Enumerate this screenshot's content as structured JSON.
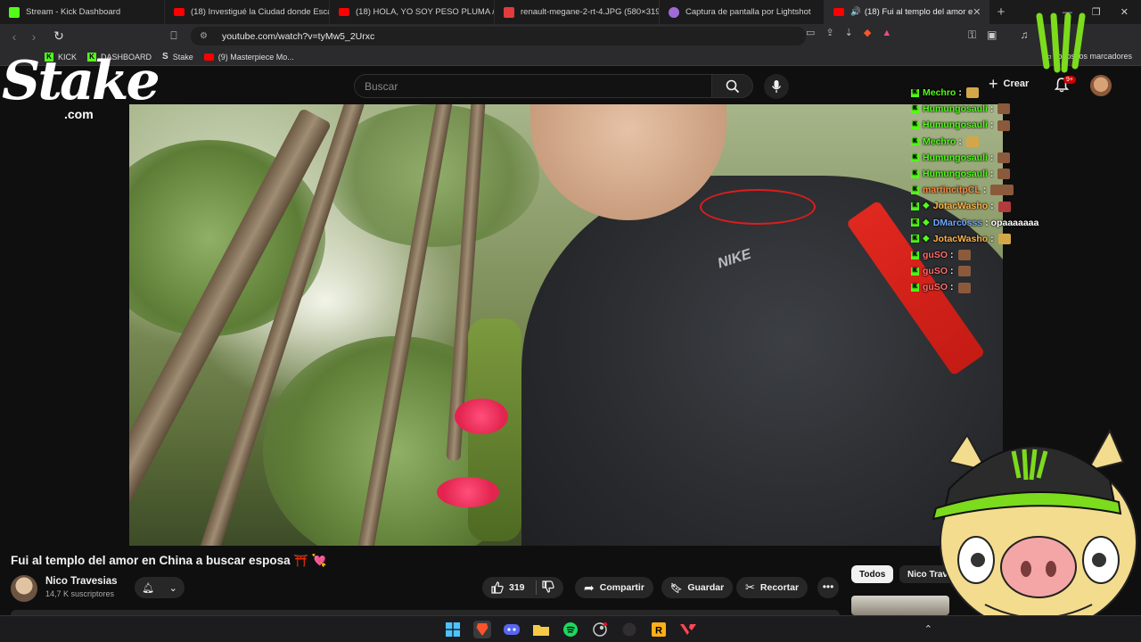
{
  "browser": {
    "tabs": [
      {
        "title": "Stream - Kick Dashboard",
        "favicon": "kick-icon",
        "color": "#53fc18",
        "active": false
      },
      {
        "title": "(18) Investigué la Ciudad donde Esca",
        "favicon": "youtube-icon",
        "color": "#ff0000",
        "active": false
      },
      {
        "title": "(18) HOLA, YO SOY PESO PLUMA // |",
        "favicon": "youtube-icon",
        "color": "#ff0000",
        "active": false
      },
      {
        "title": "renault-megane-2-rt-4.JPG (580×319",
        "favicon": "image-icon",
        "color": "#e23b3b",
        "active": false
      },
      {
        "title": "Captura de pantalla por Lightshot",
        "favicon": "feather-icon",
        "color": "#a06bd8",
        "active": false
      },
      {
        "title": "(18) Fui al templo del amor e",
        "favicon": "youtube-icon",
        "color": "#ff0000",
        "active": true
      }
    ],
    "url": "youtube.com/watch?v=tyMw5_2Urxc",
    "bookmarks": [
      {
        "label": "KICK",
        "icon": "kick-icon"
      },
      {
        "label": "DASHBOARD",
        "icon": "kick-icon"
      },
      {
        "label": "Stake",
        "icon": "stake-icon"
      },
      {
        "label": "(9) Masterpiece Mo...",
        "icon": "youtube-icon"
      }
    ],
    "all_bookmarks": "Todos los marcadores"
  },
  "youtube": {
    "search_placeholder": "Buscar",
    "create_label": "Crear",
    "notif_badge": "9+",
    "video_title": "Fui al templo del amor en China a buscar esposa ⛩️ 💘",
    "channel_name": "Nico Travesias",
    "channel_subs": "14,7 K suscriptores",
    "likes": "319",
    "share_label": "Compartir",
    "save_label": "Guardar",
    "clip_label": "Recortar",
    "chips": [
      "Todos",
      "Nico Trav"
    ]
  },
  "overlay": {
    "stake_word": "Stake",
    "stake_com": ".com",
    "chat": [
      {
        "user": "Mechro",
        "color": "#53fc18",
        "badges": 1,
        "diamond": false,
        "emote": "gold"
      },
      {
        "user": "Humungosauli",
        "color": "#53fc18",
        "badges": 1,
        "diamond": false,
        "emote": "brown"
      },
      {
        "user": "Humungosauli",
        "color": "#53fc18",
        "badges": 1,
        "diamond": false,
        "emote": "brown"
      },
      {
        "user": "Mechro",
        "color": "#53fc18",
        "badges": 1,
        "diamond": false,
        "emote": "gold"
      },
      {
        "user": "Humungosauli",
        "color": "#53fc18",
        "badges": 1,
        "diamond": false,
        "emote": "brown"
      },
      {
        "user": "Humungosauli",
        "color": "#53fc18",
        "badges": 1,
        "diamond": false,
        "emote": "brown"
      },
      {
        "user": "martincitpCL",
        "color": "#ff8a3d",
        "badges": 1,
        "diamond": false,
        "emote": "wide"
      },
      {
        "user": "JotacWasho",
        "color": "#ffb347",
        "badges": 1,
        "diamond": true,
        "emote": "red"
      },
      {
        "user": "DMarc0sss",
        "color": "#6fa8ff",
        "badges": 1,
        "diamond": true,
        "msg": "opaaaaaaa"
      },
      {
        "user": "JotacWasho",
        "color": "#ffb347",
        "badges": 1,
        "diamond": true,
        "emote": "gold"
      },
      {
        "user": "guSO",
        "color": "#ff6b6b",
        "badges": 1,
        "diamond": false,
        "emote": "brown"
      },
      {
        "user": "guSO",
        "color": "#ff6b6b",
        "badges": 1,
        "diamond": false,
        "emote": "brown"
      },
      {
        "user": "guSO",
        "color": "#ff6b6b",
        "badges": 1,
        "diamond": false,
        "emote": "brown"
      }
    ]
  },
  "taskbar": {
    "apps": [
      "windows-start-icon",
      "brave-icon",
      "discord-icon",
      "file-explorer-icon",
      "spotify-icon",
      "steam-icon",
      "obs-icon",
      "rockstar-icon",
      "valorant-icon"
    ]
  },
  "colors": {
    "kick": "#53fc18",
    "youtube_red": "#ff0000",
    "bg": "#0f0f0f",
    "monster_green": "#7cdb1c"
  }
}
